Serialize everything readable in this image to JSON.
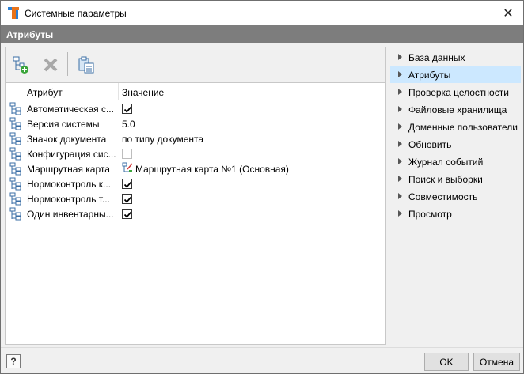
{
  "window": {
    "title": "Системные параметры",
    "close_glyph": "✕"
  },
  "section": {
    "title": "Атрибуты"
  },
  "toolbar": {
    "buttons": [
      {
        "name": "add-attribute",
        "icon": "add-attribute-icon"
      },
      {
        "name": "delete-attribute",
        "icon": "delete-icon",
        "disabled": true
      },
      {
        "name": "paste-attribute",
        "icon": "paste-icon"
      }
    ]
  },
  "grid": {
    "columns": [
      "Атрибут",
      "Значение"
    ],
    "rows": [
      {
        "name": "Автоматическая с...",
        "type": "checkbox",
        "checked": true
      },
      {
        "name": "Версия системы",
        "type": "text",
        "value": "5.0"
      },
      {
        "name": "Значок документа",
        "type": "text",
        "value": "по типу документа"
      },
      {
        "name": "Конфигурация сис...",
        "type": "checkbox",
        "checked": false
      },
      {
        "name": "Маршрутная карта",
        "type": "link",
        "value": "Маршрутная карта №1 (Основная)"
      },
      {
        "name": "Нормоконтроль к...",
        "type": "checkbox",
        "checked": true
      },
      {
        "name": "Нормоконтроль т...",
        "type": "checkbox",
        "checked": true
      },
      {
        "name": "Один инвентарны...",
        "type": "checkbox",
        "checked": true
      }
    ]
  },
  "nav": {
    "selected": 1,
    "items": [
      "База данных",
      "Атрибуты",
      "Проверка целостности",
      "Файловые хранилища",
      "Доменные пользователи",
      "Обновить",
      "Журнал событий",
      "Поиск и выборки",
      "Совместимость",
      "Просмотр"
    ]
  },
  "footer": {
    "help_label": "?",
    "ok_label": "OK",
    "cancel_label": "Отмена"
  },
  "colors": {
    "header_bg": "#7d7d7d",
    "selected_bg": "#cce8ff",
    "accent_orange": "#e8731a",
    "accent_blue": "#2a7fd4"
  }
}
